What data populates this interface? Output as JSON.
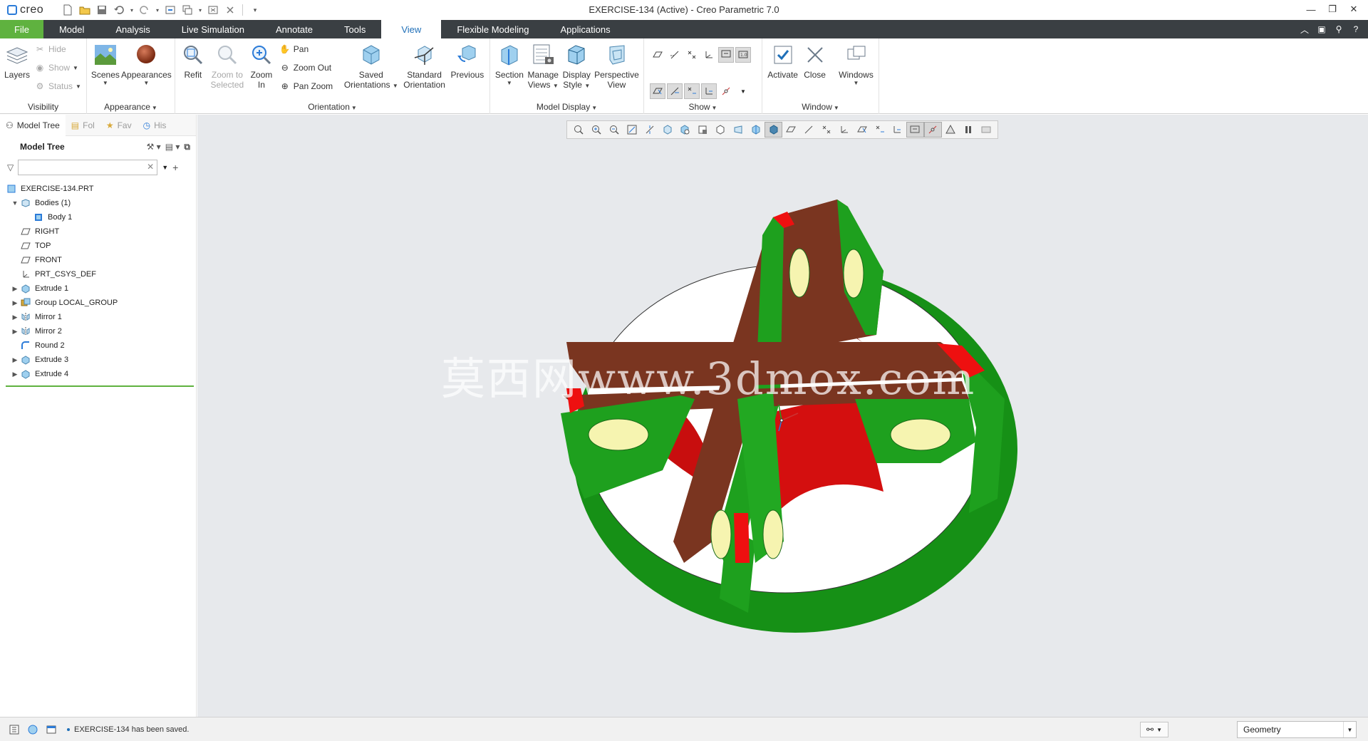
{
  "app": {
    "logo": "creo",
    "title": "EXERCISE-134 (Active) - Creo Parametric 7.0"
  },
  "tabs": [
    {
      "label": "File"
    },
    {
      "label": "Model"
    },
    {
      "label": "Analysis"
    },
    {
      "label": "Live Simulation"
    },
    {
      "label": "Annotate"
    },
    {
      "label": "Tools"
    },
    {
      "label": "View"
    },
    {
      "label": "Flexible Modeling"
    },
    {
      "label": "Applications"
    }
  ],
  "active_tab": "View",
  "ribbon": {
    "visibility": {
      "label": "Visibility",
      "layers": "Layers",
      "hide": "Hide",
      "show": "Show",
      "status": "Status"
    },
    "appearance": {
      "label": "Appearance",
      "scenes": "Scenes",
      "appearances": "Appearances"
    },
    "orientation": {
      "label": "Orientation",
      "refit": "Refit",
      "zoom_to_selected_1": "Zoom to",
      "zoom_to_selected_2": "Selected",
      "zoom_in_1": "Zoom",
      "zoom_in_2": "In",
      "pan": "Pan",
      "zoom_out": "Zoom Out",
      "pan_zoom": "Pan Zoom",
      "saved_1": "Saved",
      "saved_2": "Orientations",
      "standard_1": "Standard",
      "standard_2": "Orientation",
      "previous": "Previous"
    },
    "model_display": {
      "label": "Model Display",
      "section": "Section",
      "manage_1": "Manage",
      "manage_2": "Views",
      "display_1": "Display",
      "display_2": "Style",
      "perspective_1": "Perspective",
      "perspective_2": "View"
    },
    "show": {
      "label": "Show"
    },
    "window": {
      "label": "Window",
      "activate": "Activate",
      "close": "Close",
      "windows": "Windows"
    }
  },
  "navigator": {
    "tabs": [
      {
        "label": "Model Tree"
      },
      {
        "label": "Fol"
      },
      {
        "label": "Fav"
      },
      {
        "label": "His"
      }
    ],
    "tree_title": "Model Tree",
    "filter_placeholder": "",
    "filter_value": ""
  },
  "tree": [
    {
      "label": "EXERCISE-134.PRT",
      "expander": "",
      "icon": "part-icon"
    },
    {
      "label": "Bodies (1)",
      "expander": "▼",
      "icon": "bodies-icon"
    },
    {
      "label": "Body 1",
      "expander": "",
      "icon": "body-icon"
    },
    {
      "label": "RIGHT",
      "expander": "",
      "icon": "datum-plane-icon"
    },
    {
      "label": "TOP",
      "expander": "",
      "icon": "datum-plane-icon"
    },
    {
      "label": "FRONT",
      "expander": "",
      "icon": "datum-plane-icon"
    },
    {
      "label": "PRT_CSYS_DEF",
      "expander": "",
      "icon": "csys-icon"
    },
    {
      "label": "Extrude 1",
      "expander": "▶",
      "icon": "extrude-icon"
    },
    {
      "label": "Group LOCAL_GROUP",
      "expander": "▶",
      "icon": "group-icon"
    },
    {
      "label": "Mirror 1",
      "expander": "▶",
      "icon": "mirror-icon"
    },
    {
      "label": "Mirror 2",
      "expander": "▶",
      "icon": "mirror-icon"
    },
    {
      "label": "Round 2",
      "expander": "",
      "icon": "round-icon"
    },
    {
      "label": "Extrude 3",
      "expander": "▶",
      "icon": "extrude-icon"
    },
    {
      "label": "Extrude 4",
      "expander": "▶",
      "icon": "extrude-icon"
    }
  ],
  "watermark": "莫西网www.3dmox.com",
  "status": {
    "message": "EXERCISE-134 has been saved.",
    "selection_filter": "Geometry"
  },
  "colors": {
    "file_tab": "#5fb23f",
    "tab_bar": "#3a3f43",
    "active_tab_text": "#1f6fb8",
    "graphics_bg": "#e7e9ec",
    "model_green": "#1ea01e",
    "model_brown": "#7a3520",
    "model_red": "#d40f0f",
    "hole_yellow": "#f6f4b0"
  }
}
